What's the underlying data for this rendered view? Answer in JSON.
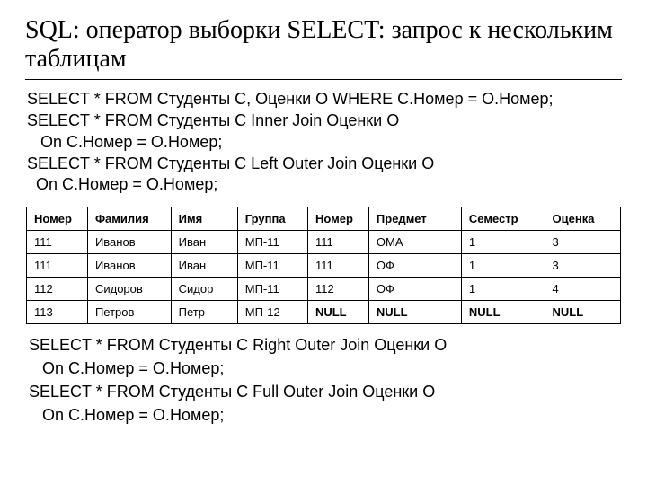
{
  "title": "SQL: оператор выборки SELECT: запрос к нескольким таблицам",
  "code_before": "SELECT * FROM Студенты С, Оценки О WHERE С.Номер = О.Номер;\nSELECT * FROM Студенты С Inner Join Оценки О\n   On С.Номер = О.Номер;\nSELECT * FROM Студенты С Left Outer Join Оценки О\n  On С.Номер = О.Номер;",
  "code_after": "SELECT * FROM Студенты С Right Outer Join Оценки О\n   On С.Номер = О.Номер;\nSELECT * FROM Студенты С Full Outer Join Оценки О\n   On С.Номер = О.Номер;",
  "chart_data": {
    "type": "table",
    "columns": [
      "Номер",
      "Фамилия",
      "Имя",
      "Группа",
      "Номер",
      "Предмет",
      "Семестр",
      "Оценка"
    ],
    "rows": [
      [
        "111",
        "Иванов",
        "Иван",
        "МП-11",
        "111",
        "ОМА",
        "1",
        "3"
      ],
      [
        "111",
        "Иванов",
        "Иван",
        "МП-11",
        "111",
        "ОФ",
        "1",
        "3"
      ],
      [
        "112",
        "Сидоров",
        "Сидор",
        "МП-11",
        "112",
        "ОФ",
        "1",
        "4"
      ],
      [
        "113",
        "Петров",
        "Петр",
        "МП-12",
        "NULL",
        "NULL",
        "NULL",
        "NULL"
      ]
    ]
  }
}
